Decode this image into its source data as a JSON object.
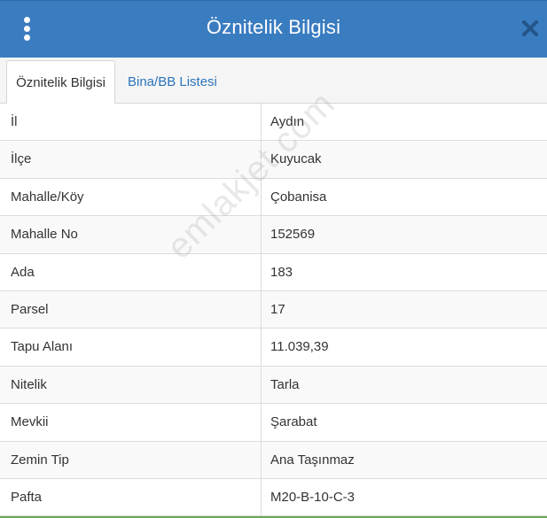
{
  "header": {
    "title": "Öznitelik Bilgisi",
    "menu_icon": "vertical-dots-icon",
    "close_icon": "close-icon"
  },
  "tabs": [
    {
      "label": "Öznitelik Bilgisi",
      "active": true
    },
    {
      "label": "Bina/BB Listesi",
      "active": false
    }
  ],
  "rows": [
    {
      "key": "İl",
      "value": "Aydın"
    },
    {
      "key": "İlçe",
      "value": "Kuyucak"
    },
    {
      "key": "Mahalle/Köy",
      "value": "Çobanisa"
    },
    {
      "key": "Mahalle No",
      "value": "152569"
    },
    {
      "key": "Ada",
      "value": "183"
    },
    {
      "key": "Parsel",
      "value": "17"
    },
    {
      "key": "Tapu Alanı",
      "value": "11.039,39"
    },
    {
      "key": "Nitelik",
      "value": "Tarla"
    },
    {
      "key": "Mevkii",
      "value": "Şarabat"
    },
    {
      "key": "Zemin Tip",
      "value": "Ana Taşınmaz"
    },
    {
      "key": "Pafta",
      "value": "M20-B-10-C-3"
    }
  ],
  "watermark": "emlakjet.com",
  "colors": {
    "header_bg": "#3a7cc0",
    "tab_link": "#2b74bb",
    "text": "#333333"
  }
}
